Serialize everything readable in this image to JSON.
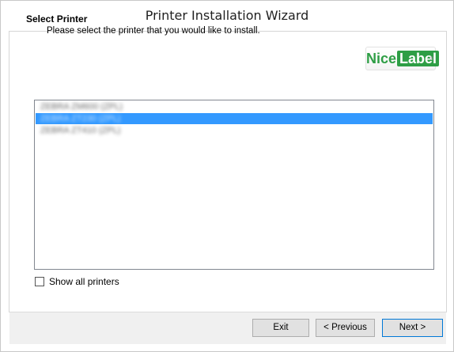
{
  "window": {
    "title": "Printer Installation Wizard"
  },
  "header": {
    "title": "Select Printer",
    "subtitle": "Please select the printer that you would like to install.",
    "logo": {
      "part1": "Nice",
      "part2": "Label",
      "reg": "®"
    }
  },
  "printer_list": {
    "items": [
      {
        "label": "ZEBRA ZM600 (ZPL)",
        "selected": false
      },
      {
        "label": "ZEBRA ZT230 (ZPL)",
        "selected": true
      },
      {
        "label": "ZEBRA ZT410 (ZPL)",
        "selected": false
      }
    ]
  },
  "options": {
    "show_all_printers_label": "Show all printers",
    "show_all_printers_checked": false
  },
  "buttons": {
    "exit": "Exit",
    "previous": "< Previous",
    "next": "Next >"
  },
  "colors": {
    "selection": "#3399ff",
    "brand_green": "#2e9e45"
  }
}
